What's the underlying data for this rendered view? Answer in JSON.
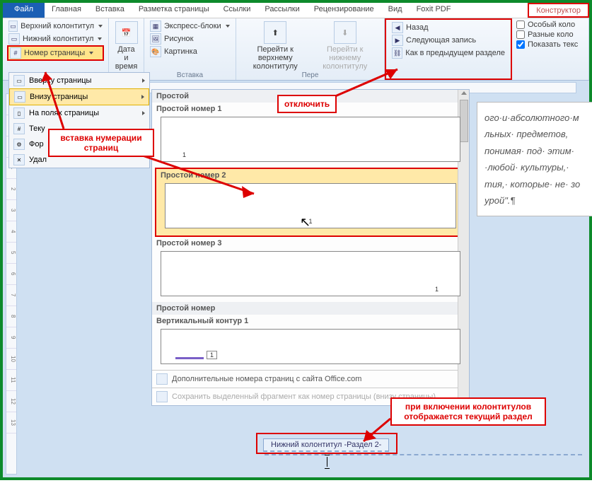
{
  "tabs": {
    "file": "Файл",
    "home": "Главная",
    "insert": "Вставка",
    "layout": "Разметка страницы",
    "refs": "Ссылки",
    "mail": "Рассылки",
    "review": "Рецензирование",
    "view": "Вид",
    "foxit": "Foxit PDF",
    "ctx": "Конструктор"
  },
  "ribbon": {
    "hf": {
      "header": "Верхний колонтитул",
      "footer": "Нижний колонтитул",
      "pagenum": "Номер страницы"
    },
    "datetime": {
      "label": "Дата и время"
    },
    "insert": {
      "quick": "Экспресс-блоки",
      "pic": "Рисунок",
      "clip": "Картинка",
      "group": "Вставка"
    },
    "nav": {
      "gotoheader": "Перейти к верхнему колонтитулу",
      "gotofooter": "Перейти к нижнему колонтитулу",
      "group": "Пере",
      "back": "Назад",
      "next": "Следующая запись",
      "link": "Как в предыдущем разделе"
    },
    "opts": {
      "special": "Особый коло",
      "different": "Разные коло",
      "showtext": "Показать текс"
    }
  },
  "dropdown": {
    "items": [
      {
        "label": "Вверху страницы"
      },
      {
        "label": "Внизу страницы"
      },
      {
        "label": "На полях страницы"
      },
      {
        "label": "Теку"
      },
      {
        "label": "Фор"
      },
      {
        "label": "Удал"
      }
    ]
  },
  "gallery": {
    "cat1": "Простой",
    "i1": "Простой номер 1",
    "i2": "Простой номер 2",
    "i3": "Простой номер 3",
    "cat2": "Простой номер",
    "i4": "Вертикальный контур 1",
    "more": "Дополнительные номера страниц с сайта Office.com",
    "save": "Сохранить выделенный фрагмент как номер страницы (внизу страницы)",
    "pn": "1"
  },
  "doc": {
    "l1": "ого·и·абсолютного·м",
    "l2": "льных·  предметов,",
    "l3": "понимая· под· этим·",
    "l4": "·любой· культуры,·",
    "l5": "тия,· которые· не· зо",
    "l6": "урой\".¶"
  },
  "footer_tab": "Нижний колонтитул -Раздел 2-",
  "callouts": {
    "c1": "вставка нумерации страниц",
    "c2": "отключить",
    "c3": "при включении колонтитулов отображается текущий раздел"
  }
}
